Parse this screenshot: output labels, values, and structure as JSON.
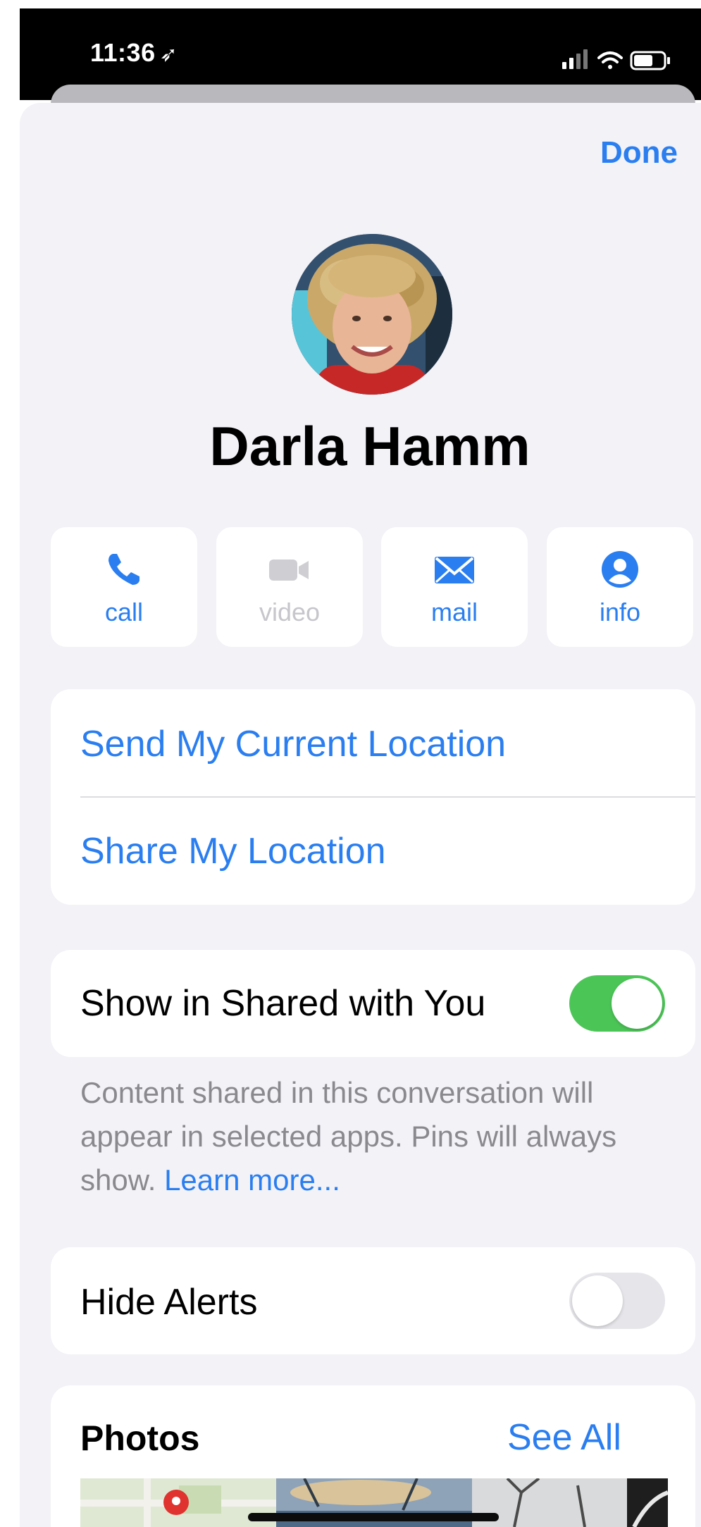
{
  "status_bar": {
    "time": "11:36",
    "location_icon": "location-arrow-icon"
  },
  "header": {
    "done_label": "Done"
  },
  "contact": {
    "name": "Darla Hamm"
  },
  "actions": [
    {
      "label": "call",
      "icon": "phone-icon",
      "enabled": true
    },
    {
      "label": "video",
      "icon": "video-camera-icon",
      "enabled": false
    },
    {
      "label": "mail",
      "icon": "envelope-icon",
      "enabled": true
    },
    {
      "label": "info",
      "icon": "person-circle-icon",
      "enabled": true
    }
  ],
  "location": {
    "send_current": "Send My Current Location",
    "share": "Share My Location"
  },
  "shared_with_you": {
    "label": "Show in Shared with You",
    "enabled": true,
    "footnote": "Content shared in this conversation will appear in selected apps. Pins will always show.",
    "learn_more": "Learn more..."
  },
  "hide_alerts": {
    "label": "Hide Alerts",
    "enabled": false
  },
  "photos": {
    "title": "Photos",
    "see_all": "See All"
  },
  "colors": {
    "accent": "#2a7ef0",
    "toggle_on": "#4cc557",
    "background": "#f2f2f7"
  }
}
